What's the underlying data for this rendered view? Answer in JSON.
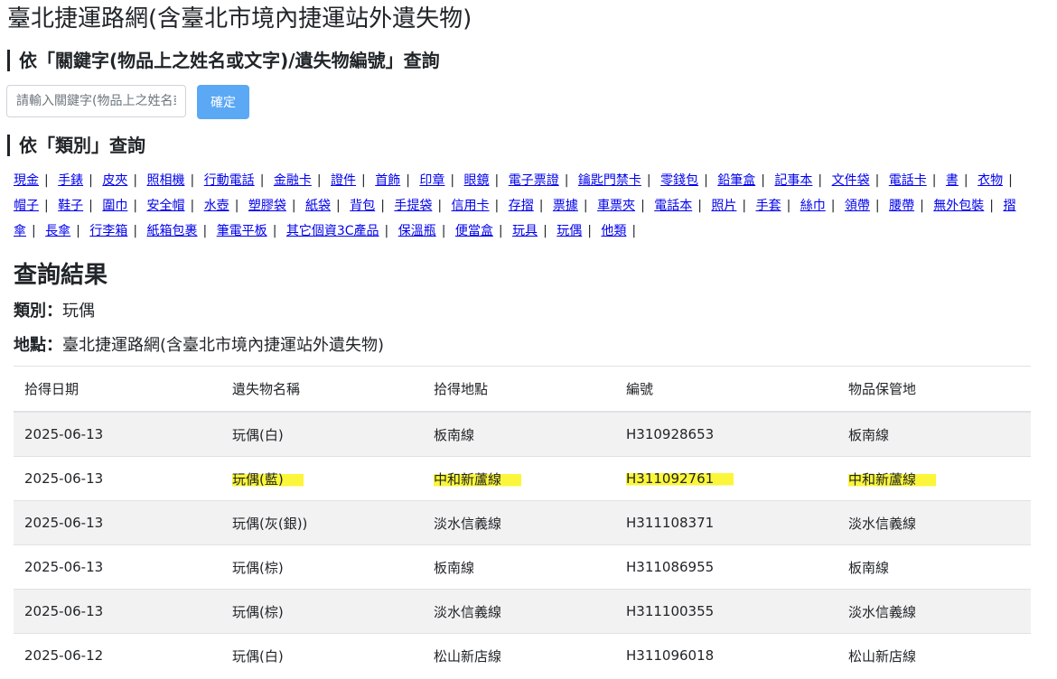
{
  "page": {
    "title": "臺北捷運路網(含臺北市境內捷運站外遺失物)"
  },
  "keyword_search": {
    "heading": "依「關鍵字(物品上之姓名或文字)/遺失物編號」查詢",
    "placeholder": "請輸入關鍵字(物品上之姓名或文字)/遺失物編號",
    "value": "",
    "button_label": "確定"
  },
  "category_search": {
    "heading": "依「類別」查詢",
    "separator": "|",
    "categories": [
      "現金",
      "手錶",
      "皮夾",
      "照相機",
      "行動電話",
      "金融卡",
      "證件",
      "首飾",
      "印章",
      "眼鏡",
      "電子票證",
      "鑰匙門禁卡",
      "零錢包",
      "鉛筆盒",
      "記事本",
      "文件袋",
      "電話卡",
      "書",
      "衣物",
      "帽子",
      "鞋子",
      "圍巾",
      "安全帽",
      "水壺",
      "塑膠袋",
      "紙袋",
      "背包",
      "手提袋",
      "信用卡",
      "存摺",
      "票據",
      "車票夾",
      "電話本",
      "照片",
      "手套",
      "絲巾",
      "領帶",
      "腰帶",
      "無外包裝",
      "摺傘",
      "長傘",
      "行李箱",
      "紙箱包裹",
      "筆電平板",
      "其它個資3C產品",
      "保溫瓶",
      "便當盒",
      "玩具",
      "玩偶",
      "他類"
    ]
  },
  "results": {
    "title": "查詢結果",
    "category_label": "類別：",
    "category_value": "玩偶",
    "location_label": "地點：",
    "location_value": "臺北捷運路網(含臺北市境內捷運站外遺失物)",
    "columns": [
      "拾得日期",
      "遺失物名稱",
      "拾得地點",
      "編號",
      "物品保管地"
    ],
    "rows": [
      [
        "2025-06-13",
        "玩偶(白)",
        "板南線",
        "H310928653",
        "板南線"
      ],
      [
        "2025-06-13",
        "玩偶(藍)",
        "中和新蘆線",
        "H311092761",
        "中和新蘆線"
      ],
      [
        "2025-06-13",
        "玩偶(灰(銀))",
        "淡水信義線",
        "H311108371",
        "淡水信義線"
      ],
      [
        "2025-06-13",
        "玩偶(棕)",
        "板南線",
        "H311086955",
        "板南線"
      ],
      [
        "2025-06-13",
        "玩偶(棕)",
        "淡水信義線",
        "H311100355",
        "淡水信義線"
      ],
      [
        "2025-06-12",
        "玩偶(白)",
        "松山新店線",
        "H311096018",
        "松山新店線"
      ]
    ],
    "highlighted_row": 1,
    "highlight_color": "#fbf63a"
  }
}
